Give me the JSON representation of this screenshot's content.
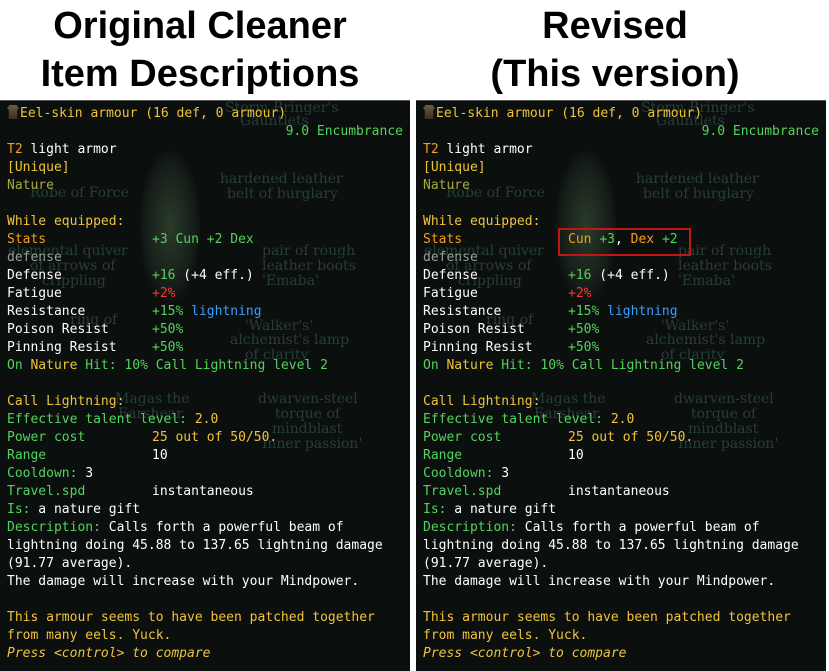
{
  "headings": {
    "left_line1": "Original Cleaner",
    "left_line2": "Item Descriptions",
    "right_line1": "Revised",
    "right_line2": "(This version)"
  },
  "ghost_text": {
    "storm1": "Storm Bringer's",
    "storm2": "Gauntlets",
    "hardened1": "hardened leather",
    "hardened2": "belt of burglary",
    "robe": "Robe of Force",
    "quiver1": "elemental quiver",
    "quiver2": "of arrows of",
    "quiver3": "crippling",
    "boots1": "pair of rough",
    "boots2": "leather boots",
    "boots3": "'Emaba'",
    "lamp1": "'Walker's'",
    "lamp2": "alchemist's lamp",
    "lamp3": "of clarity",
    "ringof": "ring of",
    "magas1": "Magas the",
    "magas2": "Earshear",
    "torque1": "dwarven-steel",
    "torque2": "torque of",
    "torque3": "mindblast",
    "torque4": "'Inner passion'"
  },
  "tooltip": {
    "title": "Eel-skin armour (16 def, 0 armour)",
    "encumbrance": "9.0 Encumbrance",
    "tier": "T2",
    "type": " light armor",
    "unique": "[Unique]",
    "school": "Nature",
    "while_equipped": "While equipped:",
    "stats_label": "Stats",
    "stats_original": "+3 Cun +2 Dex",
    "stats_revised": {
      "cun_label": "Cun",
      "cun_value": "+3",
      "sep": ",",
      "dex_label": "Dex",
      "dex_value": "+2"
    },
    "defense_old": "defense",
    "defense_label": "Defense",
    "defense_value": "+16",
    "defense_eff": " (+4 eff.)",
    "fatigue_label": "Fatigue",
    "fatigue_value": "+2%",
    "resistance_label": "Resistance",
    "resistance_value": "+15%",
    "resistance_type": " lightning",
    "poison_label": "Poison Resist",
    "poison_value": "+50%",
    "pinning_label": "Pinning Resist",
    "pinning_value": "+50%",
    "on_hit_prefix": "On ",
    "on_hit_school": "Nature",
    "on_hit_rest": " Hit: 10% Call Lightning level 2",
    "spell_title": "Call Lightning:",
    "effective_label": "Effective talent level:",
    "effective_value": " 2.0",
    "power_label": "Power cost",
    "power_value": "25 out of 50/50.",
    "range_label": "Range",
    "range_value": "10",
    "cooldown_label": "Cooldown:",
    "cooldown_value": " 3",
    "travel_label": "Travel.spd",
    "travel_value": "instantaneous",
    "is_label": "Is:",
    "is_value": " a nature gift",
    "desc_label": "Description:",
    "desc_line1": " Calls forth a powerful beam of",
    "desc_line2": "lightning doing 45.88 to 137.65 lightning damage",
    "desc_line3": "(91.77 average).",
    "desc_line4": "The damage will increase with your Mindpower.",
    "flavor1": "This armour seems to have been patched together",
    "flavor2": "from many eels. Yuck.",
    "compare": "Press <control> to compare"
  },
  "colors": {
    "gold": "#f2c23a",
    "orange": "#ff9c1a",
    "green": "#55d25d",
    "blue": "#3a9cff",
    "red": "#ff3434",
    "highlight_border": "#c21616"
  },
  "icons": [
    "armour-icon"
  ]
}
